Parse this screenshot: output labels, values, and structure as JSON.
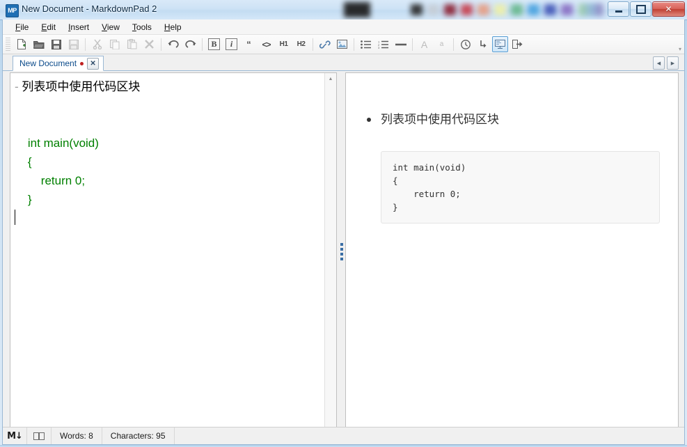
{
  "window": {
    "title": "New Document - MarkdownPad 2",
    "app_icon_label": "MP",
    "controls": {
      "minimize": "minimize-button",
      "restore": "restore-button",
      "close": "✕"
    }
  },
  "menu": {
    "items": [
      {
        "accel": "F",
        "rest": "ile"
      },
      {
        "accel": "E",
        "rest": "dit"
      },
      {
        "accel": "I",
        "rest": "nsert"
      },
      {
        "accel": "V",
        "rest": "iew"
      },
      {
        "accel": "T",
        "rest": "ools"
      },
      {
        "accel": "H",
        "rest": "elp"
      }
    ]
  },
  "toolbar": {
    "groups": [
      {
        "buttons": [
          {
            "name": "new-document-button",
            "glyph": "",
            "state": "enabled"
          },
          {
            "name": "open-document-button",
            "glyph": "",
            "state": "enabled"
          },
          {
            "name": "save-button",
            "glyph": "",
            "state": "enabled"
          },
          {
            "name": "save-as-button",
            "glyph": "",
            "state": "disabled"
          }
        ]
      },
      {
        "buttons": [
          {
            "name": "cut-button",
            "glyph": "✂",
            "state": "disabled"
          },
          {
            "name": "copy-button",
            "glyph": "",
            "state": "disabled"
          },
          {
            "name": "paste-button",
            "glyph": "",
            "state": "disabled"
          },
          {
            "name": "delete-button",
            "glyph": "✖",
            "state": "disabled"
          }
        ]
      },
      {
        "buttons": [
          {
            "name": "undo-button",
            "glyph": "↶",
            "state": "enabled"
          },
          {
            "name": "redo-button",
            "glyph": "↷",
            "state": "enabled"
          }
        ]
      },
      {
        "buttons": [
          {
            "name": "bold-button",
            "glyph": "B",
            "state": "enabled"
          },
          {
            "name": "italic-button",
            "glyph": "i",
            "state": "enabled"
          },
          {
            "name": "blockquote-button",
            "glyph": "“",
            "state": "enabled"
          },
          {
            "name": "inline-code-button",
            "glyph": "<>",
            "state": "enabled"
          },
          {
            "name": "heading1-button",
            "glyph": "H1",
            "state": "enabled"
          },
          {
            "name": "heading2-button",
            "glyph": "H2",
            "state": "enabled"
          }
        ]
      },
      {
        "buttons": [
          {
            "name": "insert-link-button",
            "glyph": "ὑ7",
            "state": "enabled"
          },
          {
            "name": "insert-image-button",
            "glyph": "",
            "state": "enabled"
          }
        ]
      },
      {
        "buttons": [
          {
            "name": "bullet-list-button",
            "glyph": "",
            "state": "enabled"
          },
          {
            "name": "numbered-list-button",
            "glyph": "",
            "state": "enabled"
          },
          {
            "name": "horizontal-rule-button",
            "glyph": "—",
            "state": "enabled"
          }
        ]
      },
      {
        "buttons": [
          {
            "name": "increase-font-button",
            "glyph": "A",
            "state": "disabled"
          },
          {
            "name": "decrease-font-button",
            "glyph": "a",
            "state": "disabled"
          }
        ]
      },
      {
        "buttons": [
          {
            "name": "insert-time-button",
            "glyph": "◷",
            "state": "enabled"
          },
          {
            "name": "word-wrap-button",
            "glyph": "↳",
            "state": "enabled"
          },
          {
            "name": "live-preview-button",
            "glyph": "",
            "state": "active"
          },
          {
            "name": "export-button",
            "glyph": "→",
            "state": "enabled"
          }
        ]
      }
    ],
    "overflow_label": "▾"
  },
  "tabs": {
    "documents": [
      {
        "label": "New Document",
        "modified": true,
        "close_label": "✕"
      }
    ],
    "nav_prev": "◀",
    "nav_next": "▶"
  },
  "editor": {
    "lines": [
      {
        "type": "markdown",
        "marker": "-",
        "text": " 列表项中使用代码区块"
      },
      {
        "type": "blank",
        "text": ""
      },
      {
        "type": "blank",
        "text": ""
      },
      {
        "type": "code",
        "text": "    int main(void)"
      },
      {
        "type": "code",
        "text": "    {"
      },
      {
        "type": "code",
        "text": "        return 0;"
      },
      {
        "type": "code",
        "text": "    }"
      },
      {
        "type": "caret",
        "text": ""
      }
    ],
    "scroll_up": "▲",
    "scroll_down": "▼"
  },
  "preview": {
    "list_items": [
      "列表项中使用代码区块"
    ],
    "code_block": "int main(void)\n{\n    return 0;\n}"
  },
  "status": {
    "markdown_logo": "M",
    "book_icon": "📖",
    "words": "Words: 8",
    "characters": "Characters: 95"
  },
  "glass_swatches": [
    "#2b2b2b",
    "#c6cdd6",
    "#8e2436",
    "#c8414f",
    "#e79e84",
    "#eef0a8",
    "#69b98e",
    "#4aa3e0",
    "#4458b8",
    "#8a6fc4"
  ],
  "colors": {
    "accent": "#1f6fb4",
    "code_green": "#008000",
    "tab_text": "#0a4a8a",
    "dirty_dot": "#c02020",
    "close_red": "#c04034"
  }
}
